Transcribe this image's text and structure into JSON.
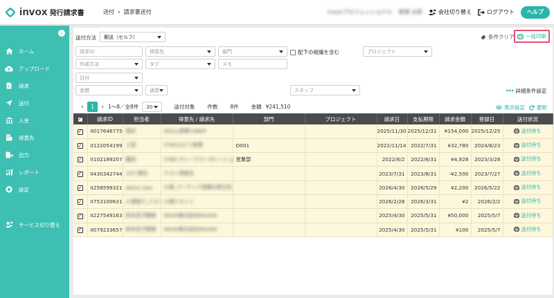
{
  "app": {
    "name": "invox",
    "subtitle": "発行請求書"
  },
  "breadcrumb": [
    "送付",
    "請求書送付"
  ],
  "header": {
    "company": "invoxプロフェッショナル",
    "user": "管理 太郎",
    "switch_company": "会社切り替え",
    "logout": "ログアウト",
    "help": "ヘルプ"
  },
  "sidebar": {
    "items": [
      {
        "label": "ホーム",
        "icon": "home-icon"
      },
      {
        "label": "アップロード",
        "icon": "upload-icon"
      },
      {
        "label": "請求",
        "icon": "document-icon"
      },
      {
        "label": "送付",
        "icon": "send-icon"
      },
      {
        "label": "入金",
        "icon": "bank-icon"
      },
      {
        "label": "得意先",
        "icon": "client-icon"
      },
      {
        "label": "出力",
        "icon": "export-icon"
      },
      {
        "label": "レポート",
        "icon": "report-icon"
      },
      {
        "label": "設定",
        "icon": "gear-icon"
      },
      {
        "label": "サービス切り替え",
        "icon": "switch-icon"
      }
    ]
  },
  "filters": {
    "send_method_label": "送付方法",
    "send_method_value": "郵送（セルフ）",
    "invoice_id": "請求ID",
    "client": "得意先",
    "department": "部門",
    "include_sub": "配下の組織を含む",
    "project": "プロジェクト",
    "creation_method": "作成方法",
    "tag": "タグ",
    "memo": "メモ",
    "date": "日付",
    "amount": "金額",
    "currency": "通貨",
    "staff": "スタッフ",
    "clear": "条件クリア",
    "print_all": "一括印刷",
    "detail": "詳細条件設定"
  },
  "summary": {
    "range": "1〜8／全8件",
    "page": "1",
    "per_page": "20",
    "target_label": "送付対象",
    "count_label": "件数",
    "count_value": "8件",
    "amount_label": "金額",
    "amount_value": "¥241,510",
    "display_settings": "表示設定",
    "refresh": "更新"
  },
  "table": {
    "columns": [
      "請求ID",
      "担当者",
      "得意先 / 請求先",
      "部門",
      "プロジェクト",
      "請求日",
      "支払期限",
      "請求金額",
      "登録日",
      "送付状況"
    ],
    "rows": [
      {
        "id": "II0176467751",
        "staff": "西村",
        "client": "みかん商事COBOY",
        "dept": "",
        "project": "",
        "date": "2025/11/30",
        "due": "2025/12/31",
        "amount": "¥154,000",
        "registered": "2025/12/25",
        "status": "送付待ち"
      },
      {
        "id": "II1220541991",
        "staff": "上田",
        "client": "CTKGエビラ商事",
        "dept": "O001",
        "project": "",
        "date": "2022/11/14",
        "due": "2022/7/31",
        "amount": "¥32,780",
        "registered": "2024/8/23",
        "status": "送付待ち"
      },
      {
        "id": "II1021892071",
        "staff": "藤田",
        "client": "CT80 グレープコーポレーション",
        "dept": "営業部",
        "project": "",
        "date": "2022/8/2",
        "due": "2022/8/31",
        "amount": "¥4,928",
        "registered": "2023/3/28",
        "status": "送付待ち"
      },
      {
        "id": "II4303427440",
        "staff": "小川 慎也",
        "client": "テスト得意先",
        "dept": "",
        "project": "",
        "date": "2023/7/31",
        "due": "2023/8/31",
        "amount": "-¥2,500",
        "registered": "2023/7/27",
        "status": "送付待ち"
      },
      {
        "id": "II2585993211",
        "staff": "demo user",
        "client": "小澤_パーテック営業お取引先",
        "dept": "",
        "project": "",
        "date": "2026/4/30",
        "due": "2026/5/29",
        "amount": "¥2,200",
        "registered": "2026/5/22",
        "status": "送付待ち"
      },
      {
        "id": "II7531006317",
        "staff": "小澤俊介_テスト",
        "client": "小澤テスト１",
        "dept": "",
        "project": "",
        "date": "2026/2/28",
        "due": "2026/3/31",
        "amount": "¥2",
        "registered": "2026/2/2",
        "status": "送付待ち"
      },
      {
        "id": "II2275491633",
        "staff": "鈴木花子開発",
        "client": "MAXK株式会社MAXDA",
        "dept": "",
        "project": "",
        "date": "2025/4/30",
        "due": "2025/5/31",
        "amount": "¥50,000",
        "registered": "2025/5/7",
        "status": "送付待ち"
      },
      {
        "id": "II0792336576",
        "staff": "鈴木花子開発",
        "client": "MAXK株式会社MAXDA",
        "dept": "",
        "project": "",
        "date": "2025/4/30",
        "due": "2025/5/31",
        "amount": "¥100",
        "registered": "2025/5/7",
        "status": "送付待ち"
      }
    ]
  }
}
